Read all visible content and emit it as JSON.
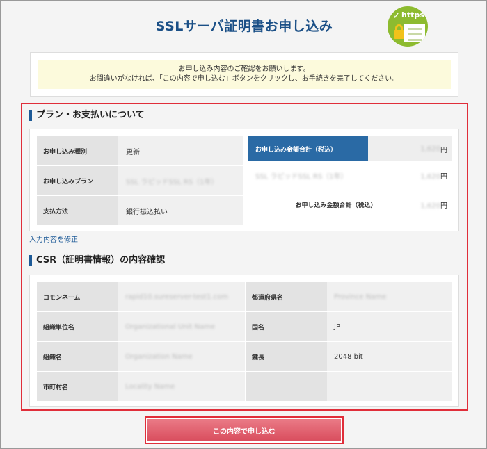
{
  "header": {
    "title": "SSLサーバ証明書お申し込み",
    "badge_text": "https",
    "badge_icon": "ssl-lock-document-icon"
  },
  "notice": {
    "line1": "お申し込み内容のご確認をお願いします。",
    "line2": "お間違いがなければ、「この内容で申し込む」ボタンをクリックし、お手続きを完了してください。"
  },
  "plan_section": {
    "title": "プラン・お支払いについて",
    "rows": [
      {
        "label": "お申し込み種別",
        "value": "更新"
      },
      {
        "label": "お申し込みプラン",
        "value": "SSL ラピッドSSL RS（1年）"
      },
      {
        "label": "支払方法",
        "value": "銀行振込払い"
      }
    ],
    "price": {
      "header_label": "お申し込み金額合計（税込）",
      "header_amount": "1,620",
      "item_label": "SSL ラピッドSSL RS（1年）",
      "item_amount": "1,620",
      "total_label": "お申し込み金額合計（税込）",
      "total_amount": "1,620",
      "currency": "円"
    },
    "edit_link": "入力内容を修正"
  },
  "csr_section": {
    "title": "CSR（証明書情報）の内容確認",
    "rows": [
      {
        "k1": "コモンネーム",
        "v1": "rapid10.sureserver-test1.com",
        "k2": "都道府県名",
        "v2": "Province Name"
      },
      {
        "k1": "組織単位名",
        "v1": "Organizational Unit Name",
        "k2": "国名",
        "v2": "JP"
      },
      {
        "k1": "組織名",
        "v1": "Organization Name",
        "k2": "鍵長",
        "v2": "2048 bit"
      },
      {
        "k1": "市町村名",
        "v1": "Locality Name",
        "k2": "",
        "v2": ""
      }
    ]
  },
  "submit": {
    "label": "この内容で申し込む"
  },
  "colors": {
    "accent": "#1d5a97",
    "highlight": "#e02e3a",
    "badge": "#8dbb2f",
    "button": "#d94d5d"
  }
}
